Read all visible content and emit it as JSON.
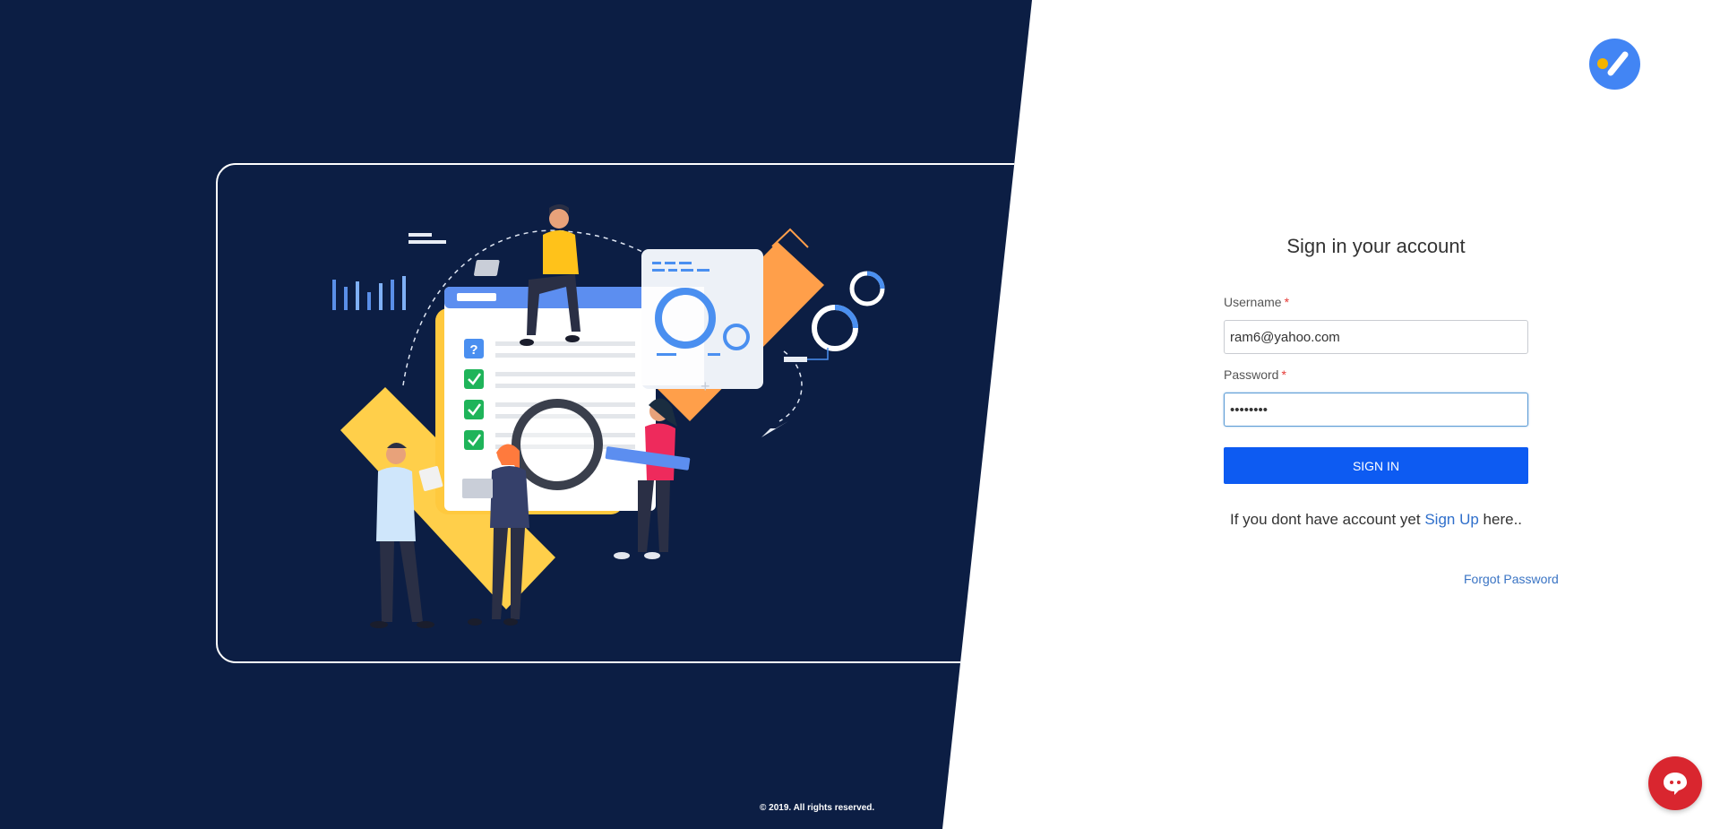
{
  "footer": {
    "copyright": "© 2019. All rights reserved."
  },
  "illustration": {
    "help_glyph": "?"
  },
  "login": {
    "title": "Sign in your account",
    "username_label": "Username",
    "username_value": "ram6@yahoo.com",
    "password_label": "Password",
    "password_value": "••••••••",
    "required_marker": "*",
    "signin_button": "SIGN IN",
    "signup_prefix": "If you dont have account yet ",
    "signup_link": "Sign Up",
    "signup_suffix": " here..",
    "forgot_password": "Forgot Password"
  },
  "icons": {
    "logo": "check-logo-icon",
    "chat": "chat-bubble-icon"
  },
  "colors": {
    "left_panel_bg": "#0c1e44",
    "primary_button": "#0d5bf2",
    "link": "#2f6fcb",
    "chat_button": "#d9262f",
    "logo_blue": "#4285f4",
    "logo_yellow": "#f4b400"
  }
}
